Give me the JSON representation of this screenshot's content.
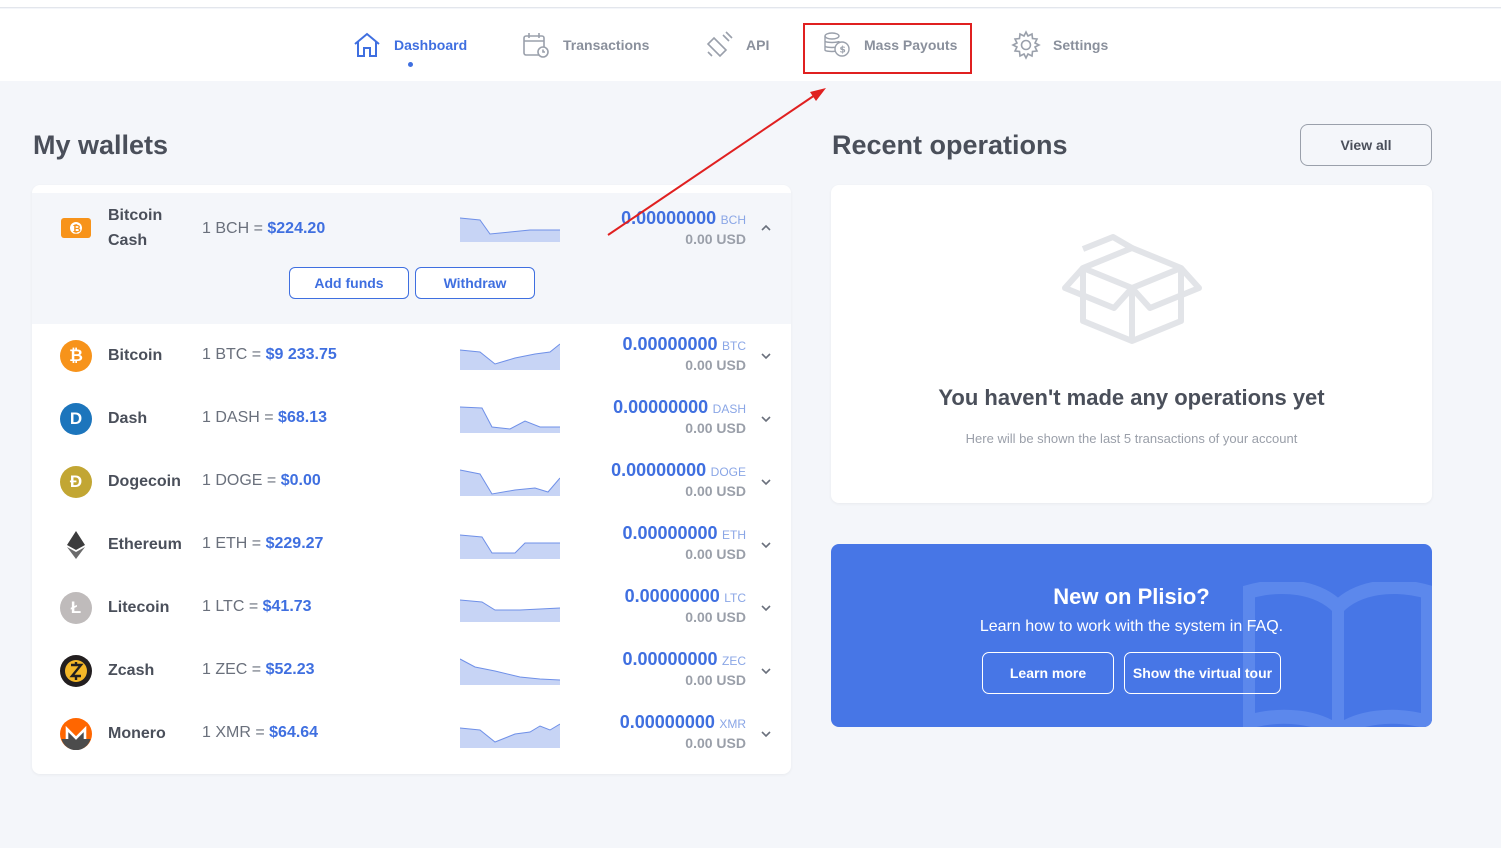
{
  "nav": {
    "items": [
      {
        "label": "Dashboard",
        "icon": "home-icon",
        "active": true
      },
      {
        "label": "Transactions",
        "icon": "calendar-icon"
      },
      {
        "label": "API",
        "icon": "plug-icon"
      },
      {
        "label": "Mass Payouts",
        "icon": "coins-icon"
      },
      {
        "label": "Settings",
        "icon": "gear-icon"
      }
    ]
  },
  "wallets": {
    "title": "My wallets",
    "add_funds": "Add funds",
    "withdraw": "Withdraw",
    "items": [
      {
        "name": "Bitcoin Cash",
        "rate_prefix": "1 BCH =",
        "price": "$224.20",
        "balance": "0.00000000",
        "unit": "BCH",
        "usd": "0.00 USD",
        "color": "#f7931a"
      },
      {
        "name": "Bitcoin",
        "rate_prefix": "1 BTC =",
        "price": "$9 233.75",
        "balance": "0.00000000",
        "unit": "BTC",
        "usd": "0.00 USD",
        "color": "#f7931a"
      },
      {
        "name": "Dash",
        "rate_prefix": "1 DASH =",
        "price": "$68.13",
        "balance": "0.00000000",
        "unit": "DASH",
        "usd": "0.00 USD",
        "color": "#1c75bc"
      },
      {
        "name": "Dogecoin",
        "rate_prefix": "1 DOGE =",
        "price": "$0.00",
        "balance": "0.00000000",
        "unit": "DOGE",
        "usd": "0.00 USD",
        "color": "#c2a633"
      },
      {
        "name": "Ethereum",
        "rate_prefix": "1 ETH =",
        "price": "$229.27",
        "balance": "0.00000000",
        "unit": "ETH",
        "usd": "0.00 USD",
        "color": "#3c3c3d"
      },
      {
        "name": "Litecoin",
        "rate_prefix": "1 LTC =",
        "price": "$41.73",
        "balance": "0.00000000",
        "unit": "LTC",
        "usd": "0.00 USD",
        "color": "#bfbbbb"
      },
      {
        "name": "Zcash",
        "rate_prefix": "1 ZEC =",
        "price": "$52.23",
        "balance": "0.00000000",
        "unit": "ZEC",
        "usd": "0.00 USD",
        "color": "#f4b728"
      },
      {
        "name": "Monero",
        "rate_prefix": "1 XMR =",
        "price": "$64.64",
        "balance": "0.00000000",
        "unit": "XMR",
        "usd": "0.00 USD",
        "color": "#ff6600"
      }
    ]
  },
  "recent": {
    "title": "Recent operations",
    "view_all": "View all",
    "empty_title": "You haven't made any operations yet",
    "empty_sub": "Here will be shown the last 5 transactions of your account"
  },
  "promo": {
    "title": "New on Plisio?",
    "subtitle": "Learn how to work with the system in FAQ.",
    "learn_more": "Learn more",
    "tour": "Show the virtual tour"
  }
}
